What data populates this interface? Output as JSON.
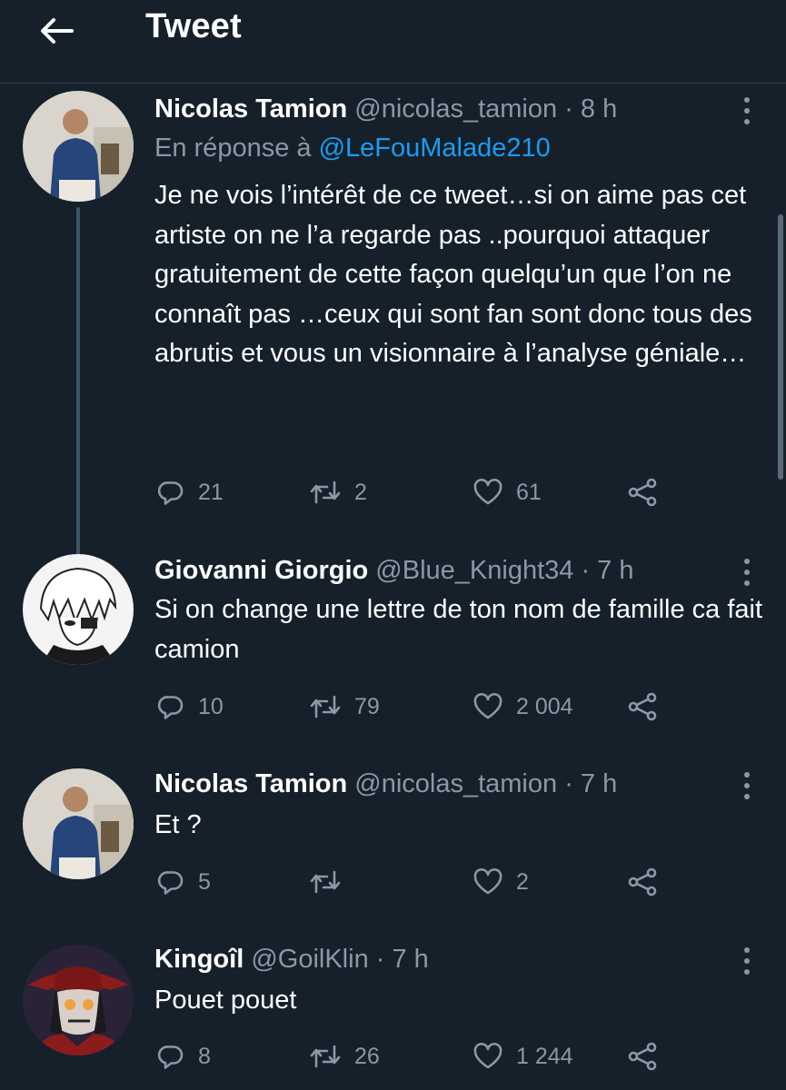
{
  "header": {
    "title": "Tweet"
  },
  "tweets": [
    {
      "name": "Nicolas Tamion",
      "handle": "@nicolas_tamion · 8 h",
      "reply_prefix": "En réponse à ",
      "reply_to": "@LeFouMalade210",
      "text": "Je ne vois l’intérêt de ce tweet…si on aime pas cet artiste on ne l’a regarde pas ..pourquoi attaquer gratuitement de cette façon quelqu’un que l’on ne connaît pas …ceux qui sont fan sont donc tous des abrutis et vous un visionnaire à l’analyse géniale…",
      "replies": "21",
      "retweets": "2",
      "likes": "61"
    },
    {
      "name": "Giovanni Giorgio",
      "handle": "@Blue_Knight34 · 7 h",
      "text": "Si on change une lettre de ton nom de famille ca fait camion",
      "replies": "10",
      "retweets": "79",
      "likes": "2 004"
    },
    {
      "name": "Nicolas Tamion",
      "handle": "@nicolas_tamion · 7 h",
      "text": "Et ?",
      "replies": "5",
      "retweets": "",
      "likes": "2"
    },
    {
      "name": "Kingoîl",
      "handle": "@GoilKlin · 7 h",
      "text": "Pouet pouet",
      "replies": "8",
      "retweets": "26",
      "likes": "1 244"
    }
  ],
  "colors": {
    "background": "#15202b",
    "secondary_text": "#8b98a5",
    "link": "#1d9bf0",
    "divider": "#2f3e4c"
  },
  "icons": [
    "back-arrow-icon",
    "more-icon",
    "reply-icon",
    "retweet-icon",
    "like-icon",
    "share-icon"
  ]
}
